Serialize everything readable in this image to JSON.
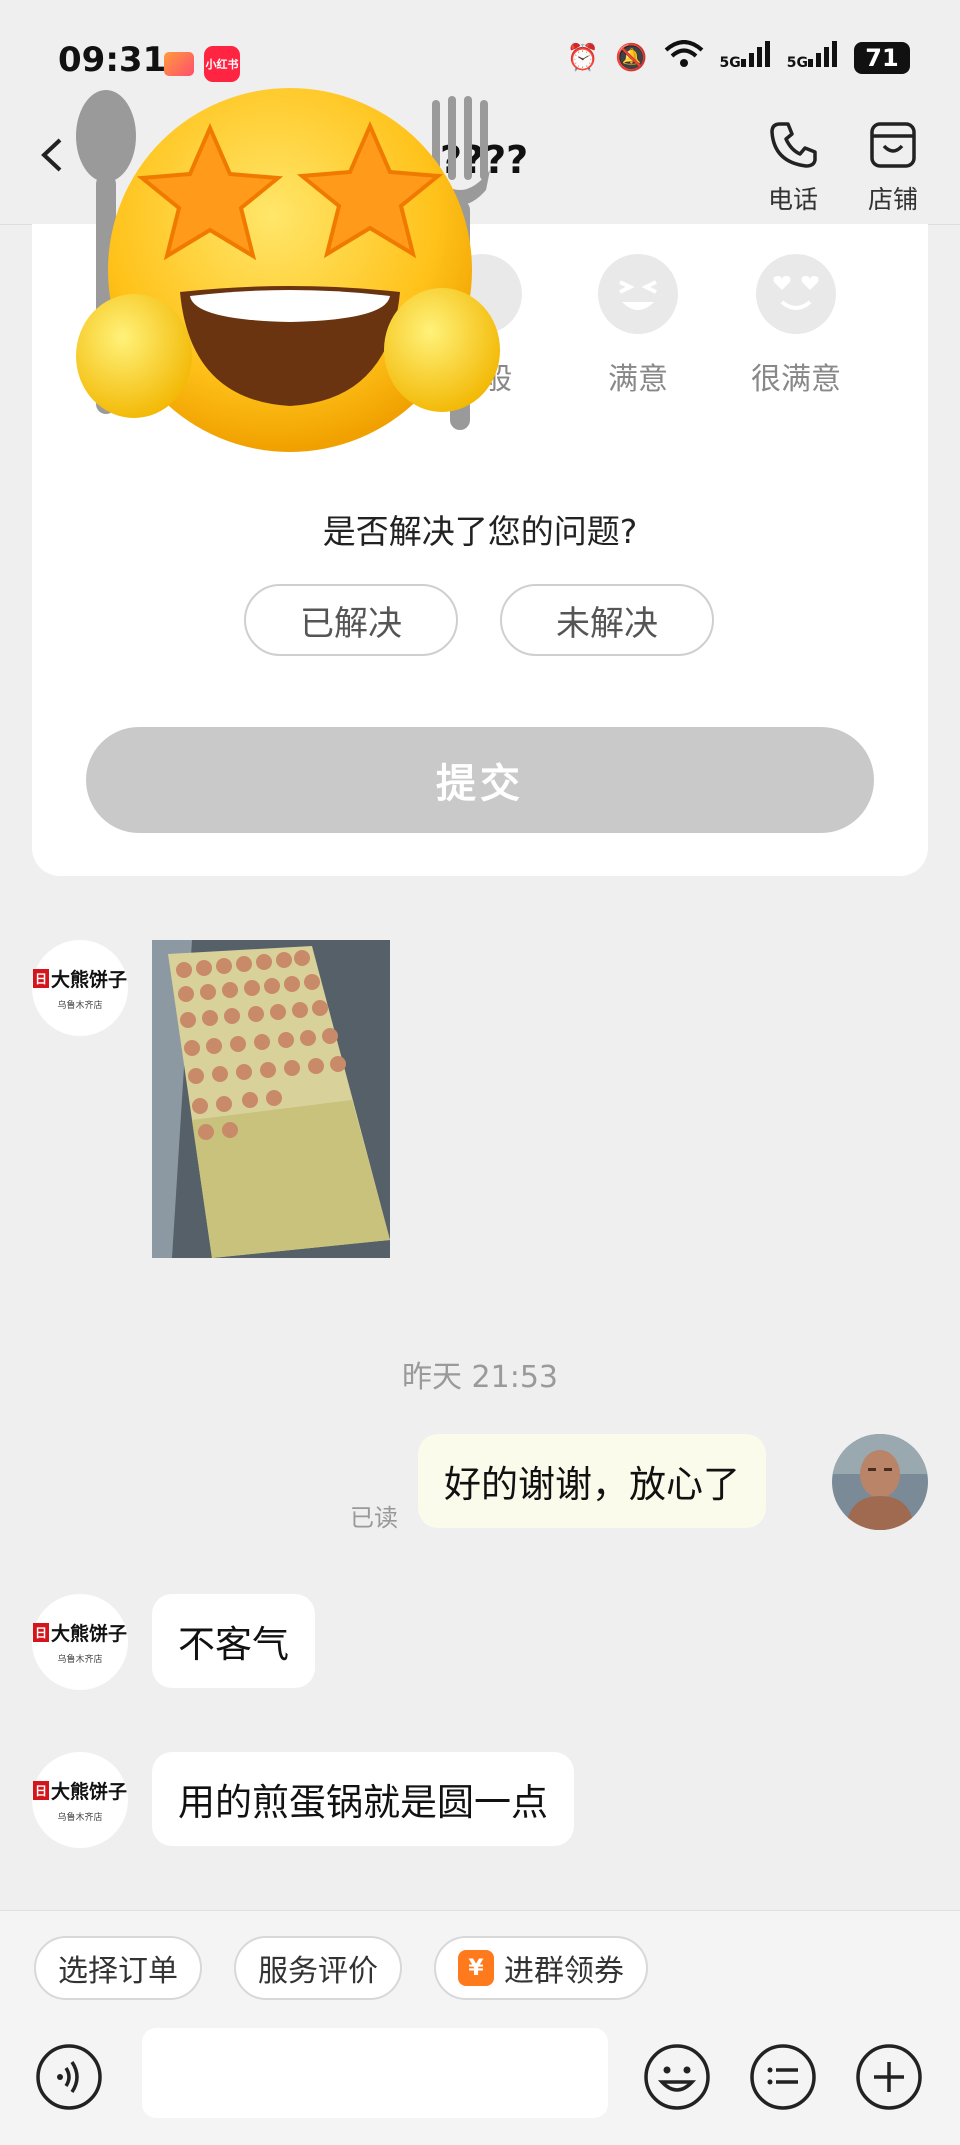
{
  "status_bar": {
    "time": "09:31",
    "app_badge": "小红书",
    "signal1": "5G",
    "signal2": "5G",
    "battery": "71"
  },
  "header": {
    "title": "????",
    "phone_label": "电话",
    "store_label": "店铺"
  },
  "rating": {
    "options": [
      "一般",
      "满意",
      "很满意"
    ]
  },
  "feedback": {
    "question": "是否解决了您的问题?",
    "resolved": "已解决",
    "unresolved": "未解决",
    "submit": "提交"
  },
  "shop": {
    "logo_text": "大熊饼子",
    "logo_badge": "日",
    "logo_sub": "乌鲁木齐店"
  },
  "chat": {
    "timestamp": "昨天 21:53",
    "read_status": "已读",
    "my_message": "好的谢谢，放心了",
    "reply1": "不客气",
    "reply2": "用的煎蛋锅就是圆一点"
  },
  "quick_actions": {
    "select_order": "选择订单",
    "service_review": "服务评价",
    "join_group": "进群领券",
    "coupon_glyph": "¥"
  },
  "colors": {
    "background": "#efefef",
    "submit_disabled": "#c9c9c9",
    "my_bubble": "#fbfbec",
    "coupon": "#ff7a1c"
  }
}
